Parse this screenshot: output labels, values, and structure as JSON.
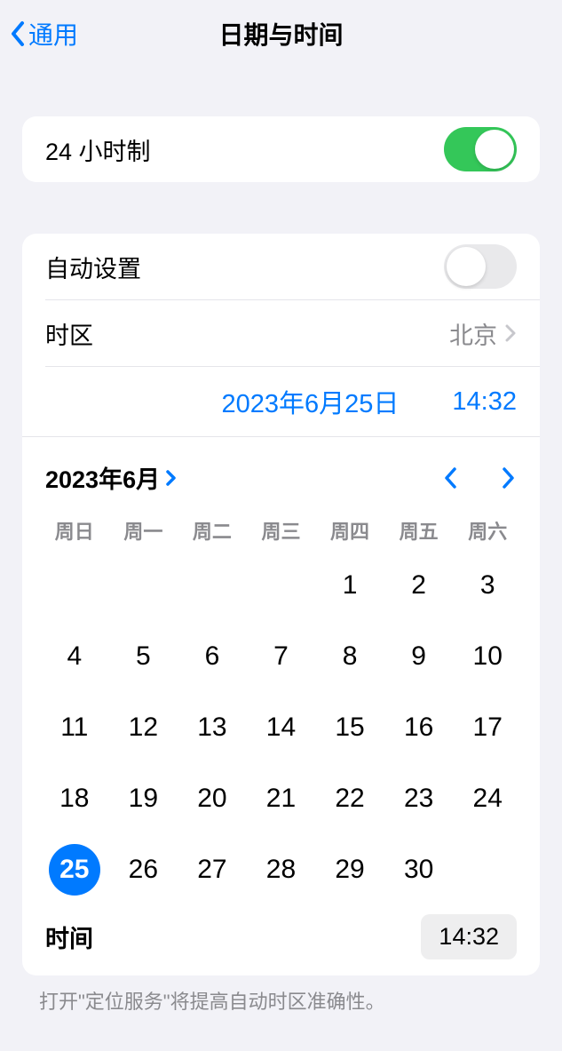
{
  "header": {
    "back_label": "通用",
    "title": "日期与时间"
  },
  "rows": {
    "twenty_four_hour_label": "24 小时制",
    "twenty_four_hour_on": true,
    "auto_set_label": "自动设置",
    "auto_set_on": false,
    "timezone_label": "时区",
    "timezone_value": "北京",
    "picker_date": "2023年6月25日",
    "picker_time": "14:32",
    "time_label": "时间",
    "time_value": "14:32"
  },
  "calendar": {
    "month_label": "2023年6月",
    "weekdays": [
      "周日",
      "周一",
      "周二",
      "周三",
      "周四",
      "周五",
      "周六"
    ],
    "leading_empty": 4,
    "days": 30,
    "selected_day": 25
  },
  "footer": {
    "note": "打开\"定位服务\"将提高自动时区准确性。"
  }
}
